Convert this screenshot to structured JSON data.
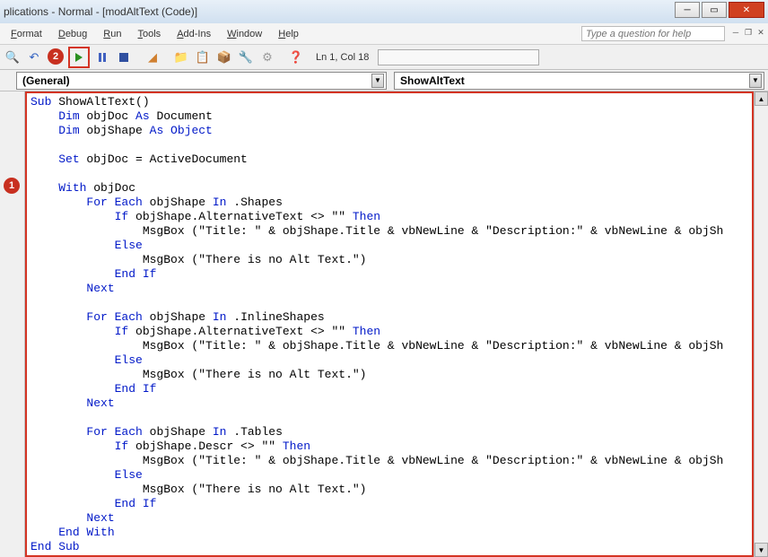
{
  "window": {
    "title": "plications - Normal - [modAltText (Code)]"
  },
  "menu": {
    "format": "Format",
    "debug": "Debug",
    "run": "Run",
    "tools": "Tools",
    "addins": "Add-Ins",
    "window": "Window",
    "help": "Help"
  },
  "help_placeholder": "Type a question for help",
  "toolbar": {
    "position": "Ln 1, Col 18"
  },
  "dropdowns": {
    "left": "(General)",
    "right": "ShowAltText"
  },
  "callouts": {
    "one": "1",
    "two": "2"
  },
  "code": {
    "l1_kw": "Sub",
    "l1_txt": " ShowAltText()",
    "l2_kw1": "Dim",
    "l2_txt1": " objDoc ",
    "l2_kw2": "As",
    "l2_txt2": " Document",
    "l3_kw1": "Dim",
    "l3_txt1": " objShape ",
    "l3_kw2": "As Object",
    "l5_kw": "Set",
    "l5_txt": " objDoc = ActiveDocument",
    "l7_kw": "With",
    "l7_txt": " objDoc",
    "l8_kw1": "For Each",
    "l8_txt1": " objShape ",
    "l8_kw2": "In",
    "l8_txt2": " .Shapes",
    "l9_kw1": "If",
    "l9_txt1": " objShape.AlternativeText <> \"\" ",
    "l9_kw2": "Then",
    "l10_txt": "MsgBox (\"Title: \" & objShape.Title & vbNewLine & \"Description:\" & vbNewLine & objSh",
    "l11_kw": "Else",
    "l12_txt": "MsgBox (\"There is no Alt Text.\")",
    "l13_kw": "End If",
    "l14_kw": "Next",
    "l16_kw1": "For Each",
    "l16_txt1": " objShape ",
    "l16_kw2": "In",
    "l16_txt2": " .InlineShapes",
    "l17_kw1": "If",
    "l17_txt1": " objShape.AlternativeText <> \"\" ",
    "l17_kw2": "Then",
    "l18_txt": "MsgBox (\"Title: \" & objShape.Title & vbNewLine & \"Description:\" & vbNewLine & objSh",
    "l19_kw": "Else",
    "l20_txt": "MsgBox (\"There is no Alt Text.\")",
    "l21_kw": "End If",
    "l22_kw": "Next",
    "l24_kw1": "For Each",
    "l24_txt1": " objShape ",
    "l24_kw2": "In",
    "l24_txt2": " .Tables",
    "l25_kw1": "If",
    "l25_txt1": " objShape.Descr <> \"\" ",
    "l25_kw2": "Then",
    "l26_txt": "MsgBox (\"Title: \" & objShape.Title & vbNewLine & \"Description:\" & vbNewLine & objSh",
    "l27_kw": "Else",
    "l28_txt": "MsgBox (\"There is no Alt Text.\")",
    "l29_kw": "End If",
    "l30_kw": "Next",
    "l31_kw": "End With",
    "l32_kw": "End Sub"
  }
}
